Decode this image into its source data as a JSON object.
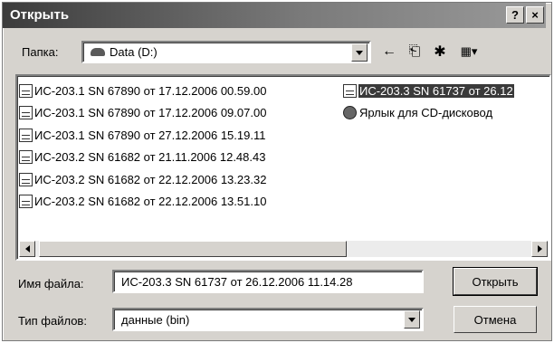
{
  "window": {
    "title": "Открыть",
    "help_label": "?",
    "close_label": "×"
  },
  "folder": {
    "label": "Папка:",
    "value": "Data (D:)"
  },
  "toolbar": {
    "back_glyph": "←",
    "up_glyph": "⎗",
    "new_folder_glyph": "✱",
    "views_glyph": "▦▾"
  },
  "files": {
    "left_column": [
      {
        "name": "ИС-203.1 SN 67890 от 17.12.2006 00.59.00"
      },
      {
        "name": "ИС-203.1 SN 67890 от 17.12.2006 09.07.00"
      },
      {
        "name": "ИС-203.1 SN 67890 от 27.12.2006 15.19.11"
      },
      {
        "name": "ИС-203.2 SN 61682 от 21.11.2006 12.48.43"
      },
      {
        "name": "ИС-203.2 SN 61682 от 22.12.2006 13.23.32"
      },
      {
        "name": "ИС-203.2 SN 61682 от 22.12.2006 13.51.10"
      }
    ],
    "right_column": [
      {
        "name": "ИС-203.3 SN 61737 от 26.12",
        "selected": true
      },
      {
        "name": "Ярлык для CD-дисковод",
        "shortcut": true
      }
    ]
  },
  "filename": {
    "label": "Имя файла:",
    "value": "ИС-203.3 SN 61737 от 26.12.2006 11.14.28"
  },
  "filetype": {
    "label": "Тип файлов:",
    "value": "данные (bin)"
  },
  "buttons": {
    "open": "Открыть",
    "cancel": "Отмена"
  },
  "colors": {
    "dialog_bg": "#d6d3ce",
    "selection": "#3a3a3a"
  }
}
